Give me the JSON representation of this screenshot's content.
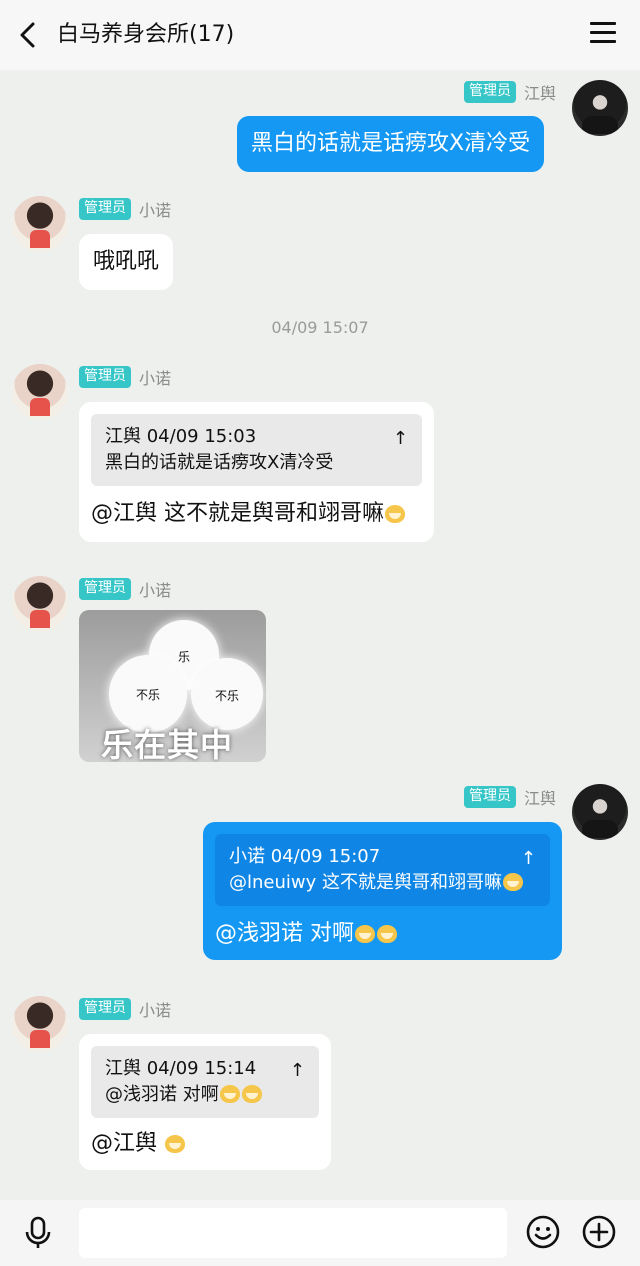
{
  "header": {
    "title": "白马养身会所(17)",
    "back_icon": "chevron-left-icon",
    "menu_icon": "hamburger-menu-icon"
  },
  "messages": [
    {
      "direction": "out",
      "badge": "管理员",
      "nick": "江舆",
      "text": "黑白的话就是话痨攻X清冷受"
    },
    {
      "direction": "in",
      "badge": "管理员",
      "nick": "小诺",
      "text": "哦吼吼"
    },
    {
      "direction": "in",
      "badge": "管理员",
      "nick": "小诺",
      "quote": {
        "header": "江舆 04/09 15:03",
        "text": "黑白的话就是话痨攻X清冷受"
      },
      "text": "@江舆 这不就是舆哥和翊哥嘛"
    },
    {
      "direction": "in",
      "badge": "管理员",
      "nick": "小诺",
      "sticker": {
        "labels": [
          "乐",
          "不乐",
          "不乐"
        ],
        "caption": "乐在其中"
      }
    },
    {
      "direction": "out",
      "badge": "管理员",
      "nick": "江舆",
      "quote": {
        "header": "小诺 04/09 15:07",
        "text": "@lneuiwy 这不就是舆哥和翊哥嘛"
      },
      "text": "@浅羽诺 对啊"
    },
    {
      "direction": "in",
      "badge": "管理员",
      "nick": "小诺",
      "quote": {
        "header": "江舆 04/09 15:14",
        "text": "@浅羽诺 对啊"
      },
      "text": "@江舆 "
    }
  ],
  "timestamp": "04/09 15:07",
  "quote_jump_icon": "↑",
  "composer": {
    "placeholder": ""
  },
  "colors": {
    "out_bubble": "#1598f4",
    "badge": "#37c6c8",
    "background": "#eef0ed"
  }
}
